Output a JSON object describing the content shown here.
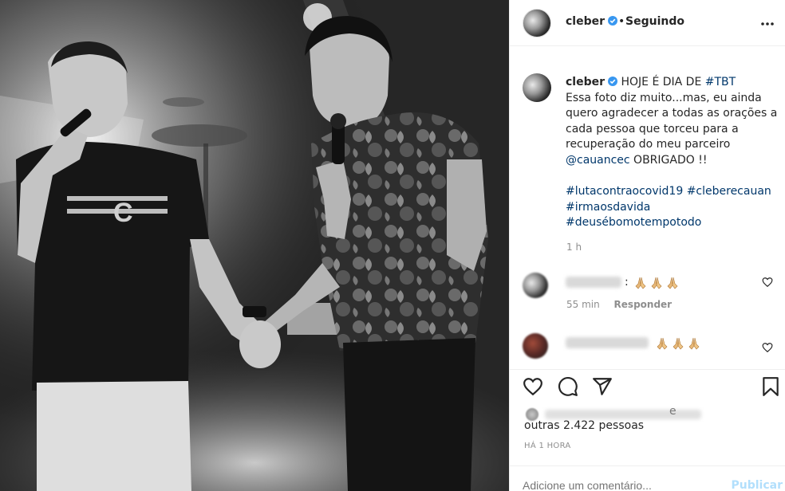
{
  "post": {
    "username": "cleber",
    "separator": "•",
    "follow_status": "Seguindo"
  },
  "caption": {
    "username": "cleber",
    "lead": "HOJE É DIA DE ",
    "lead_tag": "#TBT",
    "lines": [
      "Essa foto diz muito...mas, eu ainda",
      "quero agradecer a todas as orações a",
      "cada pessoa que torceu para a",
      "recuperação do meu parceiro"
    ],
    "mention": "@cauancec",
    "mention_after": " OBRIGADO !!",
    "hashtags_line1": [
      "#lutacontraocovid19",
      "#cleberecauan"
    ],
    "hashtags_line2": "#irmaosdavida",
    "hashtags_line3": "#deusébomotempotodo",
    "time": "1 h"
  },
  "comments": [
    {
      "time": "55 min",
      "reply_label": "Responder",
      "emoji": "folded-hands",
      "emoji_count": 3
    },
    {
      "emoji": "folded-hands",
      "emoji_count": 3
    }
  ],
  "likes": {
    "visible_letter": "e",
    "others_text": "outras 2.422 pessoas"
  },
  "timestamp": "HÁ 1 HORA",
  "comment_box": {
    "placeholder": "Adicione um comentário...",
    "publish_label": "Publicar"
  },
  "colors": {
    "accent_link": "#00376b",
    "verified_blue": "#3897f0",
    "publish_disabled": "#b2dffc",
    "muted": "#8e8e8e"
  },
  "icons": [
    "verified-badge-icon",
    "more-options-icon",
    "heart-icon",
    "comment-icon",
    "share-icon",
    "bookmark-icon",
    "folded-hands-emoji"
  ]
}
